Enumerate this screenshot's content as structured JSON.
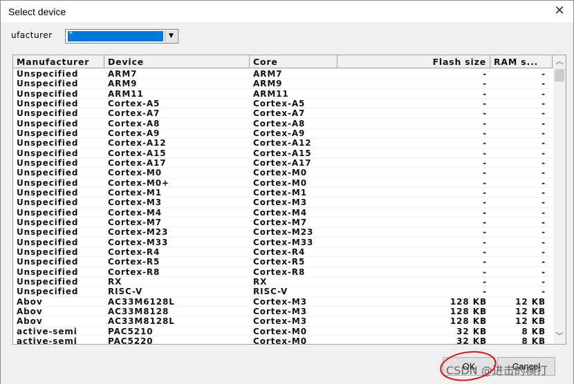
{
  "dialog": {
    "title": "Select device",
    "close_icon": "close-icon"
  },
  "filter": {
    "label": "ufacturer",
    "value": "*"
  },
  "table": {
    "columns": [
      "Manufacturer",
      "Device",
      "Core",
      "Flash size",
      "RAM s..."
    ],
    "rows": [
      [
        "Unspecified",
        "ARM7",
        "ARM7",
        "-",
        "-"
      ],
      [
        "Unspecified",
        "ARM9",
        "ARM9",
        "-",
        "-"
      ],
      [
        "Unspecified",
        "ARM11",
        "ARM11",
        "-",
        "-"
      ],
      [
        "Unspecified",
        "Cortex-A5",
        "Cortex-A5",
        "-",
        "-"
      ],
      [
        "Unspecified",
        "Cortex-A7",
        "Cortex-A7",
        "-",
        "-"
      ],
      [
        "Unspecified",
        "Cortex-A8",
        "Cortex-A8",
        "-",
        "-"
      ],
      [
        "Unspecified",
        "Cortex-A9",
        "Cortex-A9",
        "-",
        "-"
      ],
      [
        "Unspecified",
        "Cortex-A12",
        "Cortex-A12",
        "-",
        "-"
      ],
      [
        "Unspecified",
        "Cortex-A15",
        "Cortex-A15",
        "-",
        "-"
      ],
      [
        "Unspecified",
        "Cortex-A17",
        "Cortex-A17",
        "-",
        "-"
      ],
      [
        "Unspecified",
        "Cortex-M0",
        "Cortex-M0",
        "-",
        "-"
      ],
      [
        "Unspecified",
        "Cortex-M0+",
        "Cortex-M0",
        "-",
        "-"
      ],
      [
        "Unspecified",
        "Cortex-M1",
        "Cortex-M1",
        "-",
        "-"
      ],
      [
        "Unspecified",
        "Cortex-M3",
        "Cortex-M3",
        "-",
        "-"
      ],
      [
        "Unspecified",
        "Cortex-M4",
        "Cortex-M4",
        "-",
        "-"
      ],
      [
        "Unspecified",
        "Cortex-M7",
        "Cortex-M7",
        "-",
        "-"
      ],
      [
        "Unspecified",
        "Cortex-M23",
        "Cortex-M23",
        "-",
        "-"
      ],
      [
        "Unspecified",
        "Cortex-M33",
        "Cortex-M33",
        "-",
        "-"
      ],
      [
        "Unspecified",
        "Cortex-R4",
        "Cortex-R4",
        "-",
        "-"
      ],
      [
        "Unspecified",
        "Cortex-R5",
        "Cortex-R5",
        "-",
        "-"
      ],
      [
        "Unspecified",
        "Cortex-R8",
        "Cortex-R8",
        "-",
        "-"
      ],
      [
        "Unspecified",
        "RX",
        "RX",
        "-",
        "-"
      ],
      [
        "Unspecified",
        "RISC-V",
        "RISC-V",
        "-",
        "-"
      ],
      [
        "Abov",
        "AC33M6128L",
        "Cortex-M3",
        "128 KB",
        "12 KB"
      ],
      [
        "Abov",
        "AC33M8128",
        "Cortex-M3",
        "128 KB",
        "12 KB"
      ],
      [
        "Abov",
        "AC33M8128L",
        "Cortex-M3",
        "128 KB",
        "12 KB"
      ],
      [
        "active-semi",
        "PAC5210",
        "Cortex-M0",
        "32 KB",
        "8 KB"
      ],
      [
        "active-semi",
        "PAC5220",
        "Cortex-M0",
        "32 KB",
        "8 KB"
      ]
    ]
  },
  "buttons": {
    "ok": "OK",
    "cancel": "Cancel"
  },
  "watermark": "CSDN @进击的横打",
  "annotation_color": "#e01010"
}
